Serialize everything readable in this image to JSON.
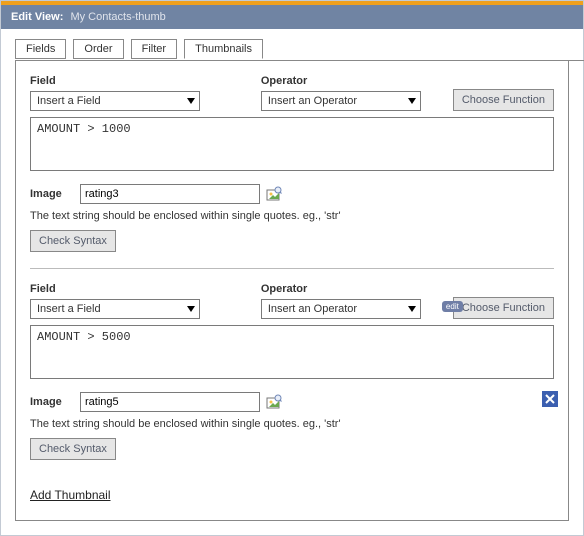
{
  "header": {
    "title_label": "Edit View:",
    "subtitle": "My Contacts-thumb"
  },
  "tabs": {
    "fields": "Fields",
    "order": "Order",
    "filter": "Filter",
    "thumbnails": "Thumbnails"
  },
  "labels": {
    "field": "Field",
    "operator": "Operator",
    "image": "Image",
    "choose_function": "Choose Function",
    "check_syntax": "Check Syntax",
    "hint": "The text string should be enclosed within single quotes. eg., 'str'",
    "add_thumbnail": "Add Thumbnail",
    "edit_badge": "edit"
  },
  "dropdown": {
    "field_placeholder": "Insert a Field",
    "operator_placeholder": "Insert an Operator"
  },
  "blocks": [
    {
      "expression": "AMOUNT > 1000",
      "image": "rating3",
      "removable": false,
      "show_edit_badge": false
    },
    {
      "expression": "AMOUNT > 5000",
      "image": "rating5",
      "removable": true,
      "show_edit_badge": true
    }
  ]
}
